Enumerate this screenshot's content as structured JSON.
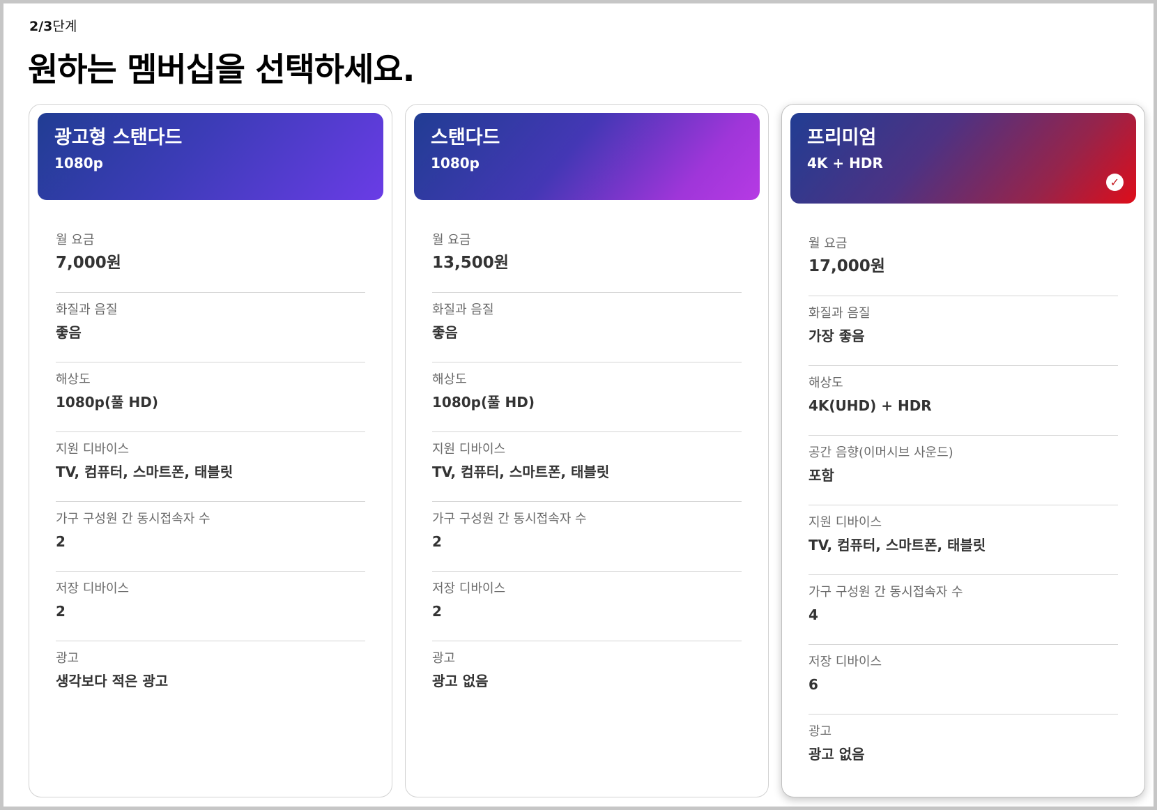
{
  "step": {
    "current": "2/3",
    "label": "단계"
  },
  "page_title": "원하는 멤버십을 선택하세요.",
  "plans": [
    {
      "name": "광고형 스탠다드",
      "resolution_short": "1080p",
      "selected": false,
      "features": [
        {
          "label": "월 요금",
          "value": "7,000원"
        },
        {
          "label": "화질과 음질",
          "value": "좋음"
        },
        {
          "label": "해상도",
          "value": "1080p(풀 HD)"
        },
        {
          "label": "지원 디바이스",
          "value": "TV, 컴퓨터, 스마트폰, 태블릿"
        },
        {
          "label": "가구 구성원 간 동시접속자 수",
          "value": "2"
        },
        {
          "label": "저장 디바이스",
          "value": "2"
        },
        {
          "label": "광고",
          "value": "생각보다 적은 광고"
        }
      ]
    },
    {
      "name": "스탠다드",
      "resolution_short": "1080p",
      "selected": false,
      "features": [
        {
          "label": "월 요금",
          "value": "13,500원"
        },
        {
          "label": "화질과 음질",
          "value": "좋음"
        },
        {
          "label": "해상도",
          "value": "1080p(풀 HD)"
        },
        {
          "label": "지원 디바이스",
          "value": "TV, 컴퓨터, 스마트폰, 태블릿"
        },
        {
          "label": "가구 구성원 간 동시접속자 수",
          "value": "2"
        },
        {
          "label": "저장 디바이스",
          "value": "2"
        },
        {
          "label": "광고",
          "value": "광고 없음"
        }
      ]
    },
    {
      "name": "프리미엄",
      "resolution_short": "4K + HDR",
      "selected": true,
      "features": [
        {
          "label": "월 요금",
          "value": "17,000원"
        },
        {
          "label": "화질과 음질",
          "value": "가장 좋음"
        },
        {
          "label": "해상도",
          "value": "4K(UHD) + HDR"
        },
        {
          "label": "공간 음향(이머시브 사운드)",
          "value": "포함"
        },
        {
          "label": "지원 디바이스",
          "value": "TV, 컴퓨터, 스마트폰, 태블릿"
        },
        {
          "label": "가구 구성원 간 동시접속자 수",
          "value": "4"
        },
        {
          "label": "저장 디바이스",
          "value": "6"
        },
        {
          "label": "광고",
          "value": "광고 없음"
        }
      ]
    }
  ],
  "colors": {
    "selected_check": "#c5141d",
    "divider": "#d4d4d4"
  },
  "icons": {
    "selected_check": "check-icon"
  }
}
